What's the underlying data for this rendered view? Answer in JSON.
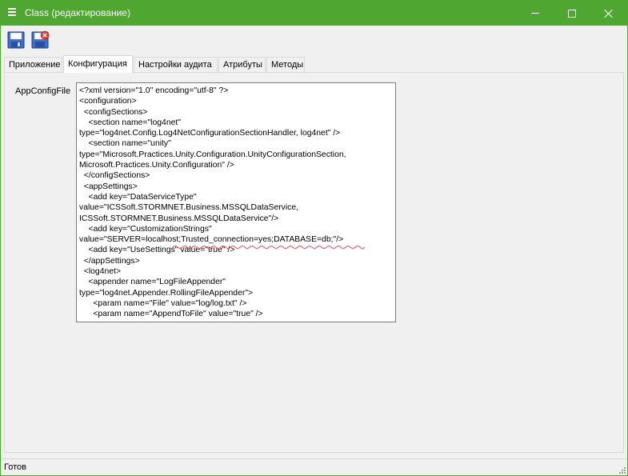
{
  "window": {
    "title": "Class (редактирование)"
  },
  "toolbar": {
    "save_icon": "save-icon",
    "save_close_icon": "save-close-icon"
  },
  "tabs": [
    {
      "label": "Приложение",
      "active": false
    },
    {
      "label": "Конфигурация",
      "active": true
    },
    {
      "label": "Настройки аудита",
      "active": false
    },
    {
      "label": "Атрибуты",
      "active": false
    },
    {
      "label": "Методы",
      "active": false
    }
  ],
  "form": {
    "field_label": "AppConfigFile",
    "config_lines": [
      "<?xml version=\"1.0\" encoding=\"utf-8\" ?>",
      "<configuration>",
      "  <configSections>",
      "    <section name=\"log4net\"",
      "type=\"log4net.Config.Log4NetConfigurationSectionHandler, log4net\" />",
      "    <section name=\"unity\"",
      "type=\"Microsoft.Practices.Unity.Configuration.UnityConfigurationSection,",
      "Microsoft.Practices.Unity.Configuration\" />",
      "  </configSections>",
      "  <appSettings>",
      "    <add key=\"DataServiceType\"",
      "value=\"ICSSoft.STORMNET.Business.MSSQLDataService,",
      "ICSSoft.STORMNET.Business.MSSQLDataService\"/>",
      "    <add key=\"CustomizationStrings\"",
      "value=\"SERVER=localhost;Trusted_connection=yes;DATABASE=db;\"/>",
      "    <add key=\"UseSettings\" value=\"true\" />",
      "  </appSettings>",
      "  <log4net>",
      "    <appender name=\"LogFileAppender\"",
      "type=\"log4net.Appender.RollingFileAppender\">",
      "      <param name=\"File\" value=\"log/log.txt\" />",
      "      <param name=\"AppendToFile\" value=\"true\" />"
    ]
  },
  "status": {
    "text": "Готов"
  },
  "colors": {
    "title_bar": "#4fa631",
    "spell_underline": "#e8505b"
  }
}
